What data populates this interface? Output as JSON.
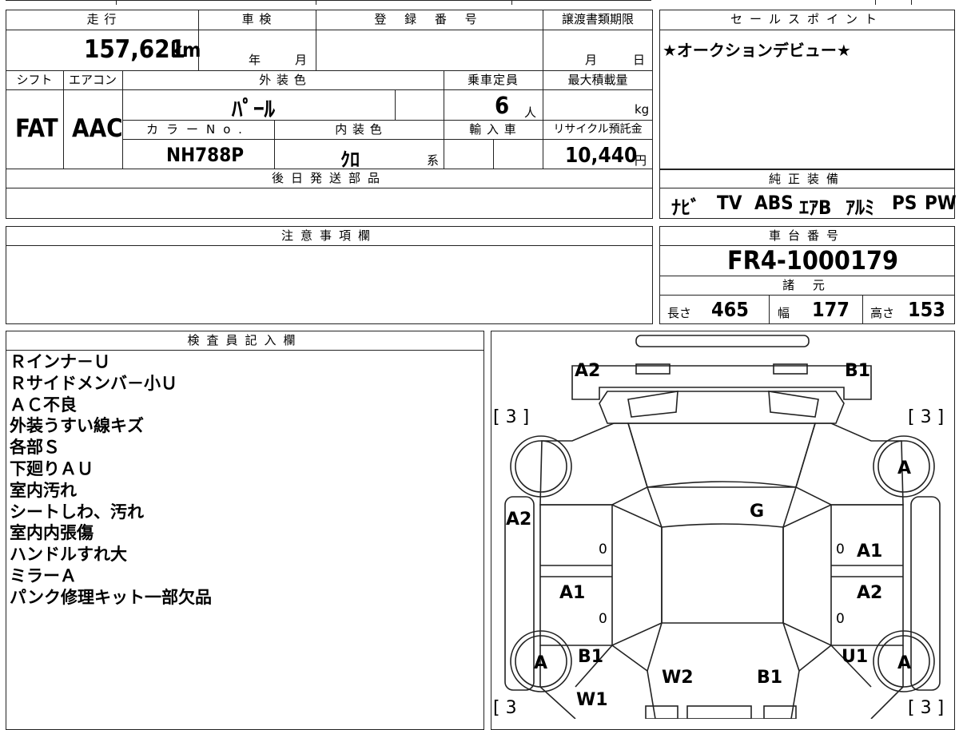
{
  "labels": {
    "mileage": "走 行",
    "inspection": "車 検",
    "registration": "登 録 番 号",
    "transfer_deadline": "譲渡書類期限",
    "sales_point": "セールスポイント",
    "shift": "シフト",
    "aircon": "エアコン",
    "exterior_color": "外 装 色",
    "capacity": "乗車定員",
    "max_load": "最大積載量",
    "color_no": "カラーNo.",
    "interior_color": "内 装 色",
    "import": "輸 入 車",
    "recycle_fee": "リサイクル預託金",
    "later_parts": "後日発送部品",
    "genuine_equipment": "純正装備",
    "cautions": "注意事項欄",
    "chassis_no": "車台番号",
    "specs": "諸 元",
    "inspector_notes": "検査員記入欄"
  },
  "values": {
    "mileage": "157,621",
    "mileage_unit": "km",
    "year_unit": "年",
    "month_unit": "月",
    "deadline_month": "月",
    "deadline_day": "日",
    "shift": "FAT",
    "aircon": "AAC",
    "exterior_color": "ﾊﾟｰﾙ",
    "capacity": "6",
    "capacity_unit": "人",
    "max_load_unit": "kg",
    "color_no": "NH788P",
    "interior_color": "ｸﾛ",
    "interior_suffix": "系",
    "recycle_fee": "10,440",
    "recycle_unit": "円",
    "sales_point": "★オークションデビュー★",
    "equipment": [
      "ﾅﾋﾞ",
      "TV",
      "ABS",
      "ｴｱB",
      "ｱﾙﾐ",
      "PS",
      "PW"
    ],
    "chassis_no": "FR4-1000179",
    "length_label": "長さ",
    "length": "465",
    "width_label": "幅",
    "width": "177",
    "height_label": "高さ",
    "height": "153"
  },
  "inspector_notes": [
    "Ｒインナ－Ｕ",
    "Ｒサイドメンバ－小Ｕ",
    "ＡＣ不良",
    "外装うすい線キズ",
    "各部Ｓ",
    "下廻りＡＵ",
    "室内汚れ",
    "シートしわ、汚れ",
    "室内内張傷",
    "ハンドルすれ大",
    "ミラーＡ",
    "パンク修理キット一部欠品"
  ],
  "diagram": {
    "front_left": "A2",
    "front_right": "B1",
    "tire_count_tl": "[ 3 ]",
    "tire_count_tr": "[ 3 ]",
    "tire_count_bl": "[ 3",
    "tire_count_br": "[ 3 ]",
    "wheel_fr": "A",
    "windshield": "G",
    "left_fender": "A2",
    "right_door_front": "A1",
    "right_door_rear": "A2",
    "left_door_rear": "A1",
    "wheel_rl": "A",
    "wheel_rr": "A",
    "rear_left_b": "B1",
    "rear_left_w": "W1",
    "rear_w2": "W2",
    "rear_b1": "B1",
    "rear_right_u": "U1",
    "zero": "0"
  }
}
